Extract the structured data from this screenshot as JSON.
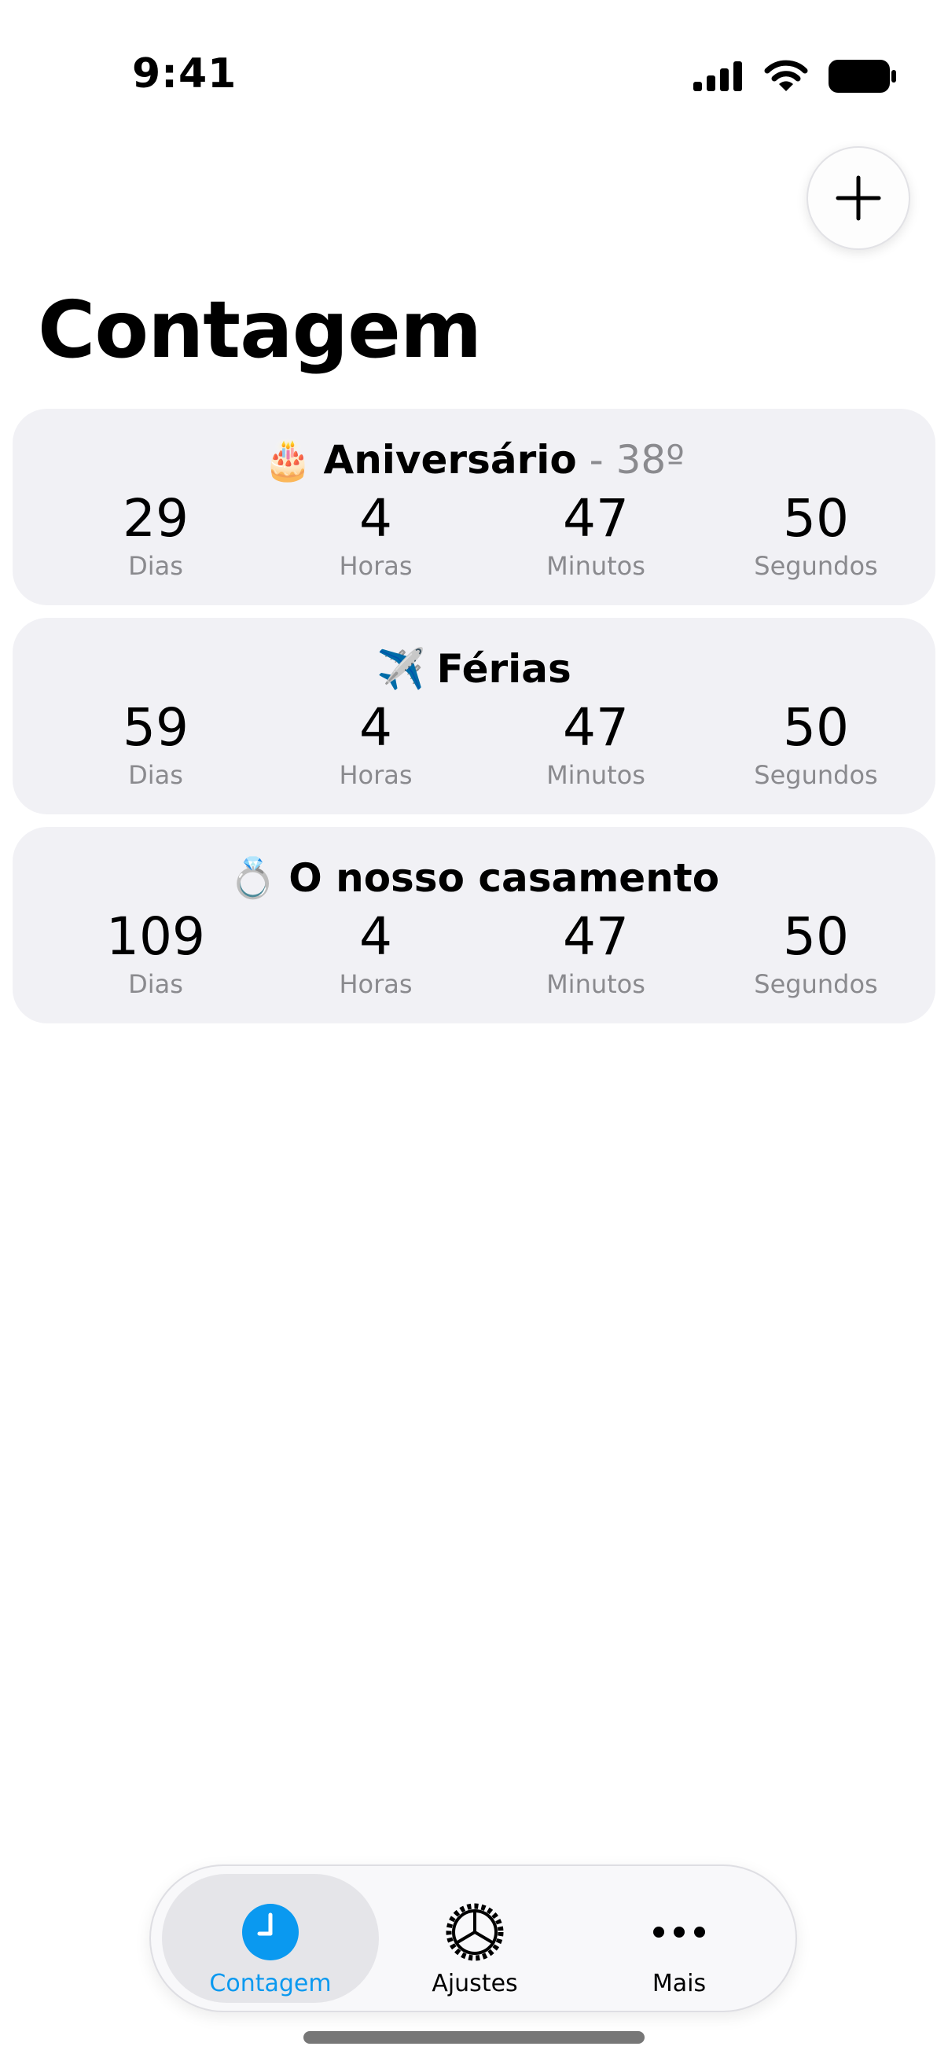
{
  "status_bar": {
    "time": "9:41"
  },
  "header": {
    "title": "Contagem",
    "add_icon": "plus-icon"
  },
  "countdowns": [
    {
      "emoji": "🎂",
      "name": "Aniversário",
      "age": " - 38º",
      "days": "29",
      "hours": "4",
      "minutes": "47",
      "seconds": "50"
    },
    {
      "emoji": "✈️",
      "name": "Férias",
      "age": "",
      "days": "59",
      "hours": "4",
      "minutes": "47",
      "seconds": "50"
    },
    {
      "emoji": "💍",
      "name": "O nosso casamento",
      "age": "",
      "days": "109",
      "hours": "4",
      "minutes": "47",
      "seconds": "50"
    }
  ],
  "unit_labels": {
    "days": "Dias",
    "hours": "Horas",
    "minutes": "Minutos",
    "seconds": "Segundos"
  },
  "tab_bar": {
    "active_color": "#0a99f0",
    "tabs": [
      {
        "label": "Contagem",
        "icon": "clock-icon",
        "active": true
      },
      {
        "label": "Ajustes",
        "icon": "gear-icon",
        "active": false
      },
      {
        "label": "Mais",
        "icon": "ellipsis-icon",
        "active": false
      }
    ]
  }
}
